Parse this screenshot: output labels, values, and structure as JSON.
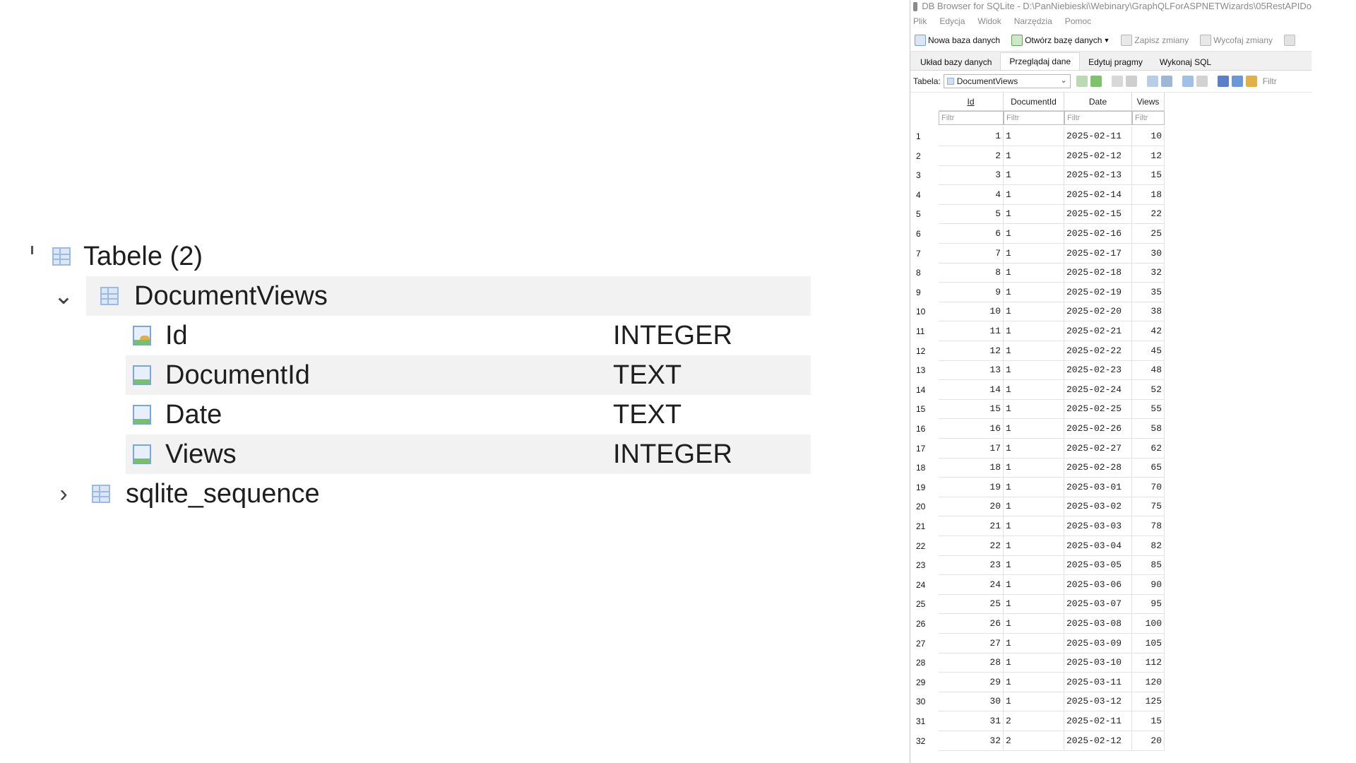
{
  "tree": {
    "tables_label": "Tabele (2)",
    "tables": [
      {
        "name": "DocumentViews",
        "expanded": true,
        "fields": [
          {
            "name": "Id",
            "type": "INTEGER",
            "key": true
          },
          {
            "name": "DocumentId",
            "type": "TEXT",
            "key": false
          },
          {
            "name": "Date",
            "type": "TEXT",
            "key": false
          },
          {
            "name": "Views",
            "type": "INTEGER",
            "key": false
          }
        ]
      },
      {
        "name": "sqlite_sequence",
        "expanded": false
      }
    ]
  },
  "app": {
    "title": "DB Browser for SQLite - D:\\PanNiebieski\\Webinary\\GraphQLForASPNETWizards\\05RestAPIDo",
    "menu": [
      "Plik",
      "Edycja",
      "Widok",
      "Narzędzia",
      "Pomoc"
    ],
    "toolbar": {
      "new_db": "Nowa baza danych",
      "open_db": "Otwórz bazę danych",
      "save": "Zapisz zmiany",
      "revert": "Wycofaj zmiany"
    },
    "tabs": [
      "Układ bazy danych",
      "Przeglądaj dane",
      "Edytuj pragmy",
      "Wykonaj SQL"
    ],
    "active_tab": 1,
    "table_label": "Tabela:",
    "table_selected": "DocumentViews",
    "filter_label": "Filtr",
    "grid": {
      "columns": [
        "Id",
        "DocumentId",
        "Date",
        "Views"
      ],
      "filter_placeholder": "Filtr",
      "rows": [
        [
          1,
          "1",
          "2025-02-11",
          10
        ],
        [
          2,
          "1",
          "2025-02-12",
          12
        ],
        [
          3,
          "1",
          "2025-02-13",
          15
        ],
        [
          4,
          "1",
          "2025-02-14",
          18
        ],
        [
          5,
          "1",
          "2025-02-15",
          22
        ],
        [
          6,
          "1",
          "2025-02-16",
          25
        ],
        [
          7,
          "1",
          "2025-02-17",
          30
        ],
        [
          8,
          "1",
          "2025-02-18",
          32
        ],
        [
          9,
          "1",
          "2025-02-19",
          35
        ],
        [
          10,
          "1",
          "2025-02-20",
          38
        ],
        [
          11,
          "1",
          "2025-02-21",
          42
        ],
        [
          12,
          "1",
          "2025-02-22",
          45
        ],
        [
          13,
          "1",
          "2025-02-23",
          48
        ],
        [
          14,
          "1",
          "2025-02-24",
          52
        ],
        [
          15,
          "1",
          "2025-02-25",
          55
        ],
        [
          16,
          "1",
          "2025-02-26",
          58
        ],
        [
          17,
          "1",
          "2025-02-27",
          62
        ],
        [
          18,
          "1",
          "2025-02-28",
          65
        ],
        [
          19,
          "1",
          "2025-03-01",
          70
        ],
        [
          20,
          "1",
          "2025-03-02",
          75
        ],
        [
          21,
          "1",
          "2025-03-03",
          78
        ],
        [
          22,
          "1",
          "2025-03-04",
          82
        ],
        [
          23,
          "1",
          "2025-03-05",
          85
        ],
        [
          24,
          "1",
          "2025-03-06",
          90
        ],
        [
          25,
          "1",
          "2025-03-07",
          95
        ],
        [
          26,
          "1",
          "2025-03-08",
          100
        ],
        [
          27,
          "1",
          "2025-03-09",
          105
        ],
        [
          28,
          "1",
          "2025-03-10",
          112
        ],
        [
          29,
          "1",
          "2025-03-11",
          120
        ],
        [
          30,
          "1",
          "2025-03-12",
          125
        ],
        [
          31,
          "2",
          "2025-02-11",
          15
        ],
        [
          32,
          "2",
          "2025-02-12",
          20
        ]
      ]
    }
  }
}
